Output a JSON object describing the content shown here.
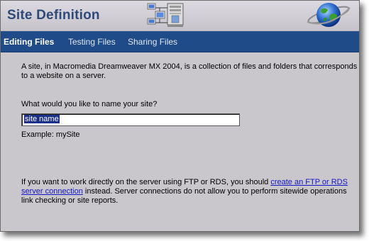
{
  "window": {
    "title": "Site Definition"
  },
  "tabs": [
    {
      "label": "Editing Files",
      "active": true
    },
    {
      "label": "Testing Files",
      "active": false
    },
    {
      "label": "Sharing Files",
      "active": false
    }
  ],
  "content": {
    "intro_line1": "A site, in Macromedia Dreamweaver MX 2004, is a collection of files and folders that corresponds",
    "intro_line2": "to a website on a server.",
    "question": "What would you like to name your site?",
    "site_name_value": "site name",
    "example": "Example: mySite",
    "ftp_text_before": "If you want to work directly on the server using FTP or RDS, you should ",
    "ftp_link_part1": "create an FTP or RDS",
    "ftp_link_part2": "server connection",
    "ftp_text_after_line2": " instead. Server connections do not allow you to perform sitewide operations",
    "ftp_text_line3": "link checking or site reports."
  },
  "colors": {
    "tab_bar": "#1f4b88",
    "title": "#2d4a7a",
    "panel": "#c9c6cc",
    "link": "#1616c8",
    "selection": "#1c2f8c"
  },
  "icons": [
    "network-computers-icon",
    "globe-icon"
  ]
}
